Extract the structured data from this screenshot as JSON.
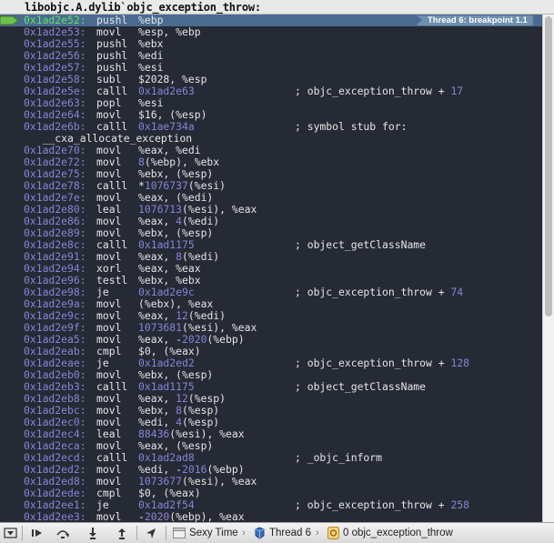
{
  "header": {
    "title": "libobjc.A.dylib`objc_exception_throw:"
  },
  "breakpoint_badge": "Thread 6: breakpoint 1.1",
  "disassembly": [
    {
      "type": "instr",
      "addr": "0x1ad2e52:",
      "mnemonic": "pushl",
      "operands": [
        {
          "t": "%ebp"
        }
      ],
      "comment": null,
      "current": true
    },
    {
      "type": "instr",
      "addr": "0x1ad2e53:",
      "mnemonic": "movl",
      "operands": [
        {
          "t": "%esp, %ebp"
        }
      ],
      "comment": null
    },
    {
      "type": "instr",
      "addr": "0x1ad2e55:",
      "mnemonic": "pushl",
      "operands": [
        {
          "t": "%ebx"
        }
      ],
      "comment": null
    },
    {
      "type": "instr",
      "addr": "0x1ad2e56:",
      "mnemonic": "pushl",
      "operands": [
        {
          "t": "%edi"
        }
      ],
      "comment": null
    },
    {
      "type": "instr",
      "addr": "0x1ad2e57:",
      "mnemonic": "pushl",
      "operands": [
        {
          "t": "%esi"
        }
      ],
      "comment": null
    },
    {
      "type": "instr",
      "addr": "0x1ad2e58:",
      "mnemonic": "subl",
      "operands": [
        {
          "t": "$2028, %esp"
        }
      ],
      "comment": null
    },
    {
      "type": "instr",
      "addr": "0x1ad2e5e:",
      "mnemonic": "calll",
      "operands": [
        {
          "t": "0x1ad2e63",
          "n": true
        }
      ],
      "comment": [
        {
          "t": "; objc_exception_throw + "
        },
        {
          "t": "17",
          "n": true
        }
      ]
    },
    {
      "type": "instr",
      "addr": "0x1ad2e63:",
      "mnemonic": "popl",
      "operands": [
        {
          "t": "%esi"
        }
      ],
      "comment": null
    },
    {
      "type": "instr",
      "addr": "0x1ad2e64:",
      "mnemonic": "movl",
      "operands": [
        {
          "t": "$16, (%esp)"
        }
      ],
      "comment": null
    },
    {
      "type": "instr",
      "addr": "0x1ad2e6b:",
      "mnemonic": "calll",
      "operands": [
        {
          "t": "0x1ae734a",
          "n": true
        }
      ],
      "comment": [
        {
          "t": "; symbol stub for:"
        }
      ]
    },
    {
      "type": "cont",
      "text": "   __cxa_allocate_exception"
    },
    {
      "type": "instr",
      "addr": "0x1ad2e70:",
      "mnemonic": "movl",
      "operands": [
        {
          "t": "%eax, %edi"
        }
      ],
      "comment": null
    },
    {
      "type": "instr",
      "addr": "0x1ad2e72:",
      "mnemonic": "movl",
      "operands": [
        {
          "t": "8",
          "n": true
        },
        {
          "t": "(%ebp), %ebx"
        }
      ],
      "comment": null
    },
    {
      "type": "instr",
      "addr": "0x1ad2e75:",
      "mnemonic": "movl",
      "operands": [
        {
          "t": "%ebx, (%esp)"
        }
      ],
      "comment": null
    },
    {
      "type": "instr",
      "addr": "0x1ad2e78:",
      "mnemonic": "calll",
      "operands": [
        {
          "t": "*"
        },
        {
          "t": "1076737",
          "n": true
        },
        {
          "t": "(%esi)"
        }
      ],
      "comment": null
    },
    {
      "type": "instr",
      "addr": "0x1ad2e7e:",
      "mnemonic": "movl",
      "operands": [
        {
          "t": "%eax, (%edi)"
        }
      ],
      "comment": null
    },
    {
      "type": "instr",
      "addr": "0x1ad2e80:",
      "mnemonic": "leal",
      "operands": [
        {
          "t": "1076713",
          "n": true
        },
        {
          "t": "(%esi), %eax"
        }
      ],
      "comment": null
    },
    {
      "type": "instr",
      "addr": "0x1ad2e86:",
      "mnemonic": "movl",
      "operands": [
        {
          "t": "%eax, "
        },
        {
          "t": "4",
          "n": true
        },
        {
          "t": "(%edi)"
        }
      ],
      "comment": null
    },
    {
      "type": "instr",
      "addr": "0x1ad2e89:",
      "mnemonic": "movl",
      "operands": [
        {
          "t": "%ebx, (%esp)"
        }
      ],
      "comment": null
    },
    {
      "type": "instr",
      "addr": "0x1ad2e8c:",
      "mnemonic": "calll",
      "operands": [
        {
          "t": "0x1ad1175",
          "n": true
        }
      ],
      "comment": [
        {
          "t": "; object_getClassName"
        }
      ]
    },
    {
      "type": "instr",
      "addr": "0x1ad2e91:",
      "mnemonic": "movl",
      "operands": [
        {
          "t": "%eax, "
        },
        {
          "t": "8",
          "n": true
        },
        {
          "t": "(%edi)"
        }
      ],
      "comment": null
    },
    {
      "type": "instr",
      "addr": "0x1ad2e94:",
      "mnemonic": "xorl",
      "operands": [
        {
          "t": "%eax, %eax"
        }
      ],
      "comment": null
    },
    {
      "type": "instr",
      "addr": "0x1ad2e96:",
      "mnemonic": "testl",
      "operands": [
        {
          "t": "%ebx, %ebx"
        }
      ],
      "comment": null
    },
    {
      "type": "instr",
      "addr": "0x1ad2e98:",
      "mnemonic": "je",
      "operands": [
        {
          "t": "0x1ad2e9c",
          "n": true
        }
      ],
      "comment": [
        {
          "t": "; objc_exception_throw + "
        },
        {
          "t": "74",
          "n": true
        }
      ]
    },
    {
      "type": "instr",
      "addr": "0x1ad2e9a:",
      "mnemonic": "movl",
      "operands": [
        {
          "t": "(%ebx), %eax"
        }
      ],
      "comment": null
    },
    {
      "type": "instr",
      "addr": "0x1ad2e9c:",
      "mnemonic": "movl",
      "operands": [
        {
          "t": "%eax, "
        },
        {
          "t": "12",
          "n": true
        },
        {
          "t": "(%edi)"
        }
      ],
      "comment": null
    },
    {
      "type": "instr",
      "addr": "0x1ad2e9f:",
      "mnemonic": "movl",
      "operands": [
        {
          "t": "1073681",
          "n": true
        },
        {
          "t": "(%esi), %eax"
        }
      ],
      "comment": null
    },
    {
      "type": "instr",
      "addr": "0x1ad2ea5:",
      "mnemonic": "movl",
      "operands": [
        {
          "t": "%eax, -"
        },
        {
          "t": "2020",
          "n": true
        },
        {
          "t": "(%ebp)"
        }
      ],
      "comment": null
    },
    {
      "type": "instr",
      "addr": "0x1ad2eab:",
      "mnemonic": "cmpl",
      "operands": [
        {
          "t": "$0, (%eax)"
        }
      ],
      "comment": null
    },
    {
      "type": "instr",
      "addr": "0x1ad2eae:",
      "mnemonic": "je",
      "operands": [
        {
          "t": "0x1ad2ed2",
          "n": true
        }
      ],
      "comment": [
        {
          "t": "; objc_exception_throw + "
        },
        {
          "t": "128",
          "n": true
        }
      ]
    },
    {
      "type": "instr",
      "addr": "0x1ad2eb0:",
      "mnemonic": "movl",
      "operands": [
        {
          "t": "%ebx, (%esp)"
        }
      ],
      "comment": null
    },
    {
      "type": "instr",
      "addr": "0x1ad2eb3:",
      "mnemonic": "calll",
      "operands": [
        {
          "t": "0x1ad1175",
          "n": true
        }
      ],
      "comment": [
        {
          "t": "; object_getClassName"
        }
      ]
    },
    {
      "type": "instr",
      "addr": "0x1ad2eb8:",
      "mnemonic": "movl",
      "operands": [
        {
          "t": "%eax, "
        },
        {
          "t": "12",
          "n": true
        },
        {
          "t": "(%esp)"
        }
      ],
      "comment": null
    },
    {
      "type": "instr",
      "addr": "0x1ad2ebc:",
      "mnemonic": "movl",
      "operands": [
        {
          "t": "%ebx, "
        },
        {
          "t": "8",
          "n": true
        },
        {
          "t": "(%esp)"
        }
      ],
      "comment": null
    },
    {
      "type": "instr",
      "addr": "0x1ad2ec0:",
      "mnemonic": "movl",
      "operands": [
        {
          "t": "%edi, "
        },
        {
          "t": "4",
          "n": true
        },
        {
          "t": "(%esp)"
        }
      ],
      "comment": null
    },
    {
      "type": "instr",
      "addr": "0x1ad2ec4:",
      "mnemonic": "leal",
      "operands": [
        {
          "t": "88436",
          "n": true
        },
        {
          "t": "(%esi), %eax"
        }
      ],
      "comment": null
    },
    {
      "type": "instr",
      "addr": "0x1ad2eca:",
      "mnemonic": "movl",
      "operands": [
        {
          "t": "%eax, (%esp)"
        }
      ],
      "comment": null
    },
    {
      "type": "instr",
      "addr": "0x1ad2ecd:",
      "mnemonic": "calll",
      "operands": [
        {
          "t": "0x1ad2ad8",
          "n": true
        }
      ],
      "comment": [
        {
          "t": "; _objc_inform"
        }
      ]
    },
    {
      "type": "instr",
      "addr": "0x1ad2ed2:",
      "mnemonic": "movl",
      "operands": [
        {
          "t": "%edi, -"
        },
        {
          "t": "2016",
          "n": true
        },
        {
          "t": "(%ebp)"
        }
      ],
      "comment": null
    },
    {
      "type": "instr",
      "addr": "0x1ad2ed8:",
      "mnemonic": "movl",
      "operands": [
        {
          "t": "1073677",
          "n": true
        },
        {
          "t": "(%esi), %eax"
        }
      ],
      "comment": null
    },
    {
      "type": "instr",
      "addr": "0x1ad2ede:",
      "mnemonic": "cmpl",
      "operands": [
        {
          "t": "$0, (%eax)"
        }
      ],
      "comment": null
    },
    {
      "type": "instr",
      "addr": "0x1ad2ee1:",
      "mnemonic": "je",
      "operands": [
        {
          "t": "0x1ad2f54",
          "n": true
        }
      ],
      "comment": [
        {
          "t": "; objc_exception_throw + "
        },
        {
          "t": "258",
          "n": true
        }
      ]
    },
    {
      "type": "instr",
      "addr": "0x1ad2ee3:",
      "mnemonic": "movl",
      "operands": [
        {
          "t": "-"
        },
        {
          "t": "2020",
          "n": true
        },
        {
          "t": "(%ebp), %eax"
        }
      ],
      "comment": null
    }
  ],
  "toolbar": {
    "buttons": [
      {
        "name": "hide-debug-area-button",
        "icon": "hide-debug-area-icon"
      },
      {
        "name": "continue-button",
        "icon": "continue-icon"
      },
      {
        "name": "step-over-button",
        "icon": "step-over-icon"
      },
      {
        "name": "step-into-button",
        "icon": "step-into-icon"
      },
      {
        "name": "step-out-button",
        "icon": "step-out-icon"
      },
      {
        "name": "location-button",
        "icon": "location-arrow-icon"
      }
    ],
    "breadcrumbs": [
      {
        "label": "Sexy Time",
        "icon": "app-icon"
      },
      {
        "label": "Thread 6",
        "icon": "thread-icon"
      },
      {
        "label": "0 objc_exception_throw",
        "icon": "stack-frame-icon"
      }
    ]
  },
  "colors": {
    "background": "#262a35",
    "address": "#8b83d8",
    "current_address": "#5fe06b",
    "text": "#e6e6e6",
    "pc_highlight": "#4a6b8f"
  }
}
